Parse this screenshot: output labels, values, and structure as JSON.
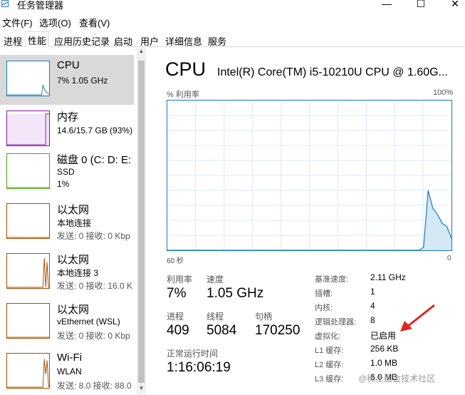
{
  "window": {
    "title": "任务管理器",
    "minimize": "—",
    "maximize": "☐",
    "close": "✕"
  },
  "menu": {
    "file": "文件(F)",
    "options": "选项(O)",
    "view": "查看(V)"
  },
  "tabs": [
    {
      "label": "进程"
    },
    {
      "label": "性能"
    },
    {
      "label": "应用历史记录"
    },
    {
      "label": "启动"
    },
    {
      "label": "用户"
    },
    {
      "label": "详细信息"
    },
    {
      "label": "服务"
    }
  ],
  "sidebar": {
    "items": [
      {
        "title": "CPU",
        "line1": "7%  1.05 GHz",
        "color": "#117dbb"
      },
      {
        "title": "内存",
        "line1": "14.6/15.7 GB (93%)",
        "color": "#8b12ae"
      },
      {
        "title": "磁盘 0 (C: D: E:",
        "line1": "SSD",
        "line2": "1%",
        "color": "#4da60c"
      },
      {
        "title": "以太网",
        "line1": "本地连接",
        "line2": "发送: 0 接收: 0 Kbp",
        "color": "#a74f01"
      },
      {
        "title": "以太网",
        "line1": "本地连接 3",
        "line2": "发送: 0 接收: 16.0 K",
        "color": "#a74f01"
      },
      {
        "title": "以太网",
        "line1": "vEthernet (WSL)",
        "line2": "发送: 0 接收: 0 Kbp",
        "color": "#a74f01"
      },
      {
        "title": "Wi-Fi",
        "line1": "WLAN",
        "line2": "发送: 8.0 接收: 88.0",
        "color": "#a74f01"
      }
    ]
  },
  "main": {
    "title": "CPU",
    "processor": "Intel(R) Core(TM) i5-10210U CPU @ 1.60G...",
    "util_label": "% 利用率",
    "util_max": "100%",
    "axis_left": "60 秒",
    "axis_right": "0",
    "graph_color": "#117dbb",
    "graph_fill": "#d4e8f5",
    "cpu_history_percent": [
      0,
      0,
      0,
      0,
      0,
      0,
      0,
      0,
      0,
      0,
      0,
      0,
      0,
      0,
      0,
      0,
      0,
      0,
      0,
      0,
      0,
      0,
      0,
      0,
      0,
      0,
      0,
      0,
      0,
      0,
      0,
      0,
      0,
      0,
      0,
      0,
      0,
      0,
      0,
      0,
      0,
      0,
      0,
      0,
      0,
      0,
      0,
      0,
      0,
      0,
      0,
      0,
      0,
      0,
      0,
      2,
      40,
      28,
      24,
      18,
      16,
      8
    ]
  },
  "stats": {
    "utilization_label": "利用率",
    "utilization": "7%",
    "speed_label": "速度",
    "speed": "1.05 GHz",
    "processes_label": "进程",
    "processes": "409",
    "threads_label": "线程",
    "threads": "5084",
    "handles_label": "句柄",
    "handles": "170250",
    "uptime_label": "正常运行时间",
    "uptime": "1:16:06:19"
  },
  "details": [
    {
      "label": "基准速度:",
      "value": "2.11 GHz"
    },
    {
      "label": "插槽:",
      "value": "1"
    },
    {
      "label": "内核:",
      "value": "4"
    },
    {
      "label": "逻辑处理器:",
      "value": "8"
    },
    {
      "label": "虚拟化:",
      "value": "已启用"
    },
    {
      "label": "L1 缓存:",
      "value": "256 KB"
    },
    {
      "label": "L2 缓存:",
      "value": "1.0 MB"
    },
    {
      "label": "L3 缓存:",
      "value": "6.0 MB"
    }
  ],
  "annotation": {
    "arrow_color": "#e8231a"
  },
  "watermark": "@稀土掘金技术社区"
}
